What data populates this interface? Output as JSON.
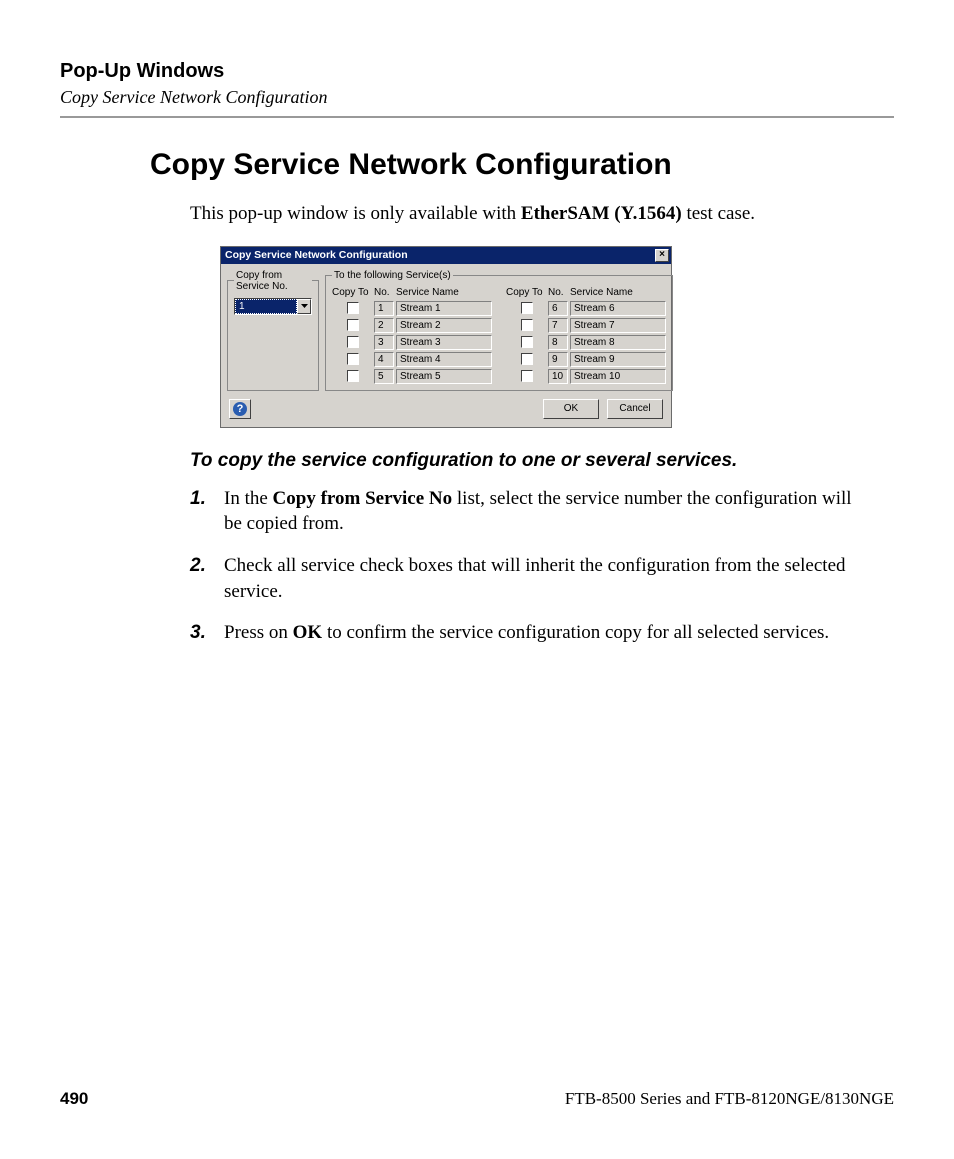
{
  "header": {
    "chapter": "Pop-Up Windows",
    "section": "Copy Service Network Configuration"
  },
  "title": "Copy Service Network Configuration",
  "intro": {
    "pre": "This pop-up window is only available with ",
    "bold": "EtherSAM (Y.1564)",
    "post": " test case."
  },
  "dialog": {
    "title": "Copy Service Network Configuration",
    "close": "×",
    "from_legend": "Copy from Service No.",
    "from_value": "1",
    "to_legend": "To the following Service(s)",
    "columns": {
      "copy": "Copy To",
      "no": "No.",
      "name": "Service Name"
    },
    "left": [
      {
        "no": "1",
        "name": "Stream 1"
      },
      {
        "no": "2",
        "name": "Stream 2"
      },
      {
        "no": "3",
        "name": "Stream 3"
      },
      {
        "no": "4",
        "name": "Stream 4"
      },
      {
        "no": "5",
        "name": "Stream 5"
      }
    ],
    "right": [
      {
        "no": "6",
        "name": "Stream 6"
      },
      {
        "no": "7",
        "name": "Stream 7"
      },
      {
        "no": "8",
        "name": "Stream 8"
      },
      {
        "no": "9",
        "name": "Stream 9"
      },
      {
        "no": "10",
        "name": "Stream 10"
      }
    ],
    "help": "?",
    "ok": "OK",
    "cancel": "Cancel"
  },
  "instructions": {
    "title": "To copy the service configuration to one or several services.",
    "steps": {
      "s1": {
        "pre": "In the ",
        "bold": "Copy from Service No",
        "post": " list, select the service number the configuration will be copied from."
      },
      "s2": {
        "text": "Check all service check boxes that will inherit the configuration from the selected service."
      },
      "s3": {
        "pre": "Press on ",
        "bold": "OK",
        "post": " to confirm the service configuration copy for all selected services."
      }
    }
  },
  "footer": {
    "page": "490",
    "product": "FTB-8500 Series and FTB-8120NGE/8130NGE"
  }
}
